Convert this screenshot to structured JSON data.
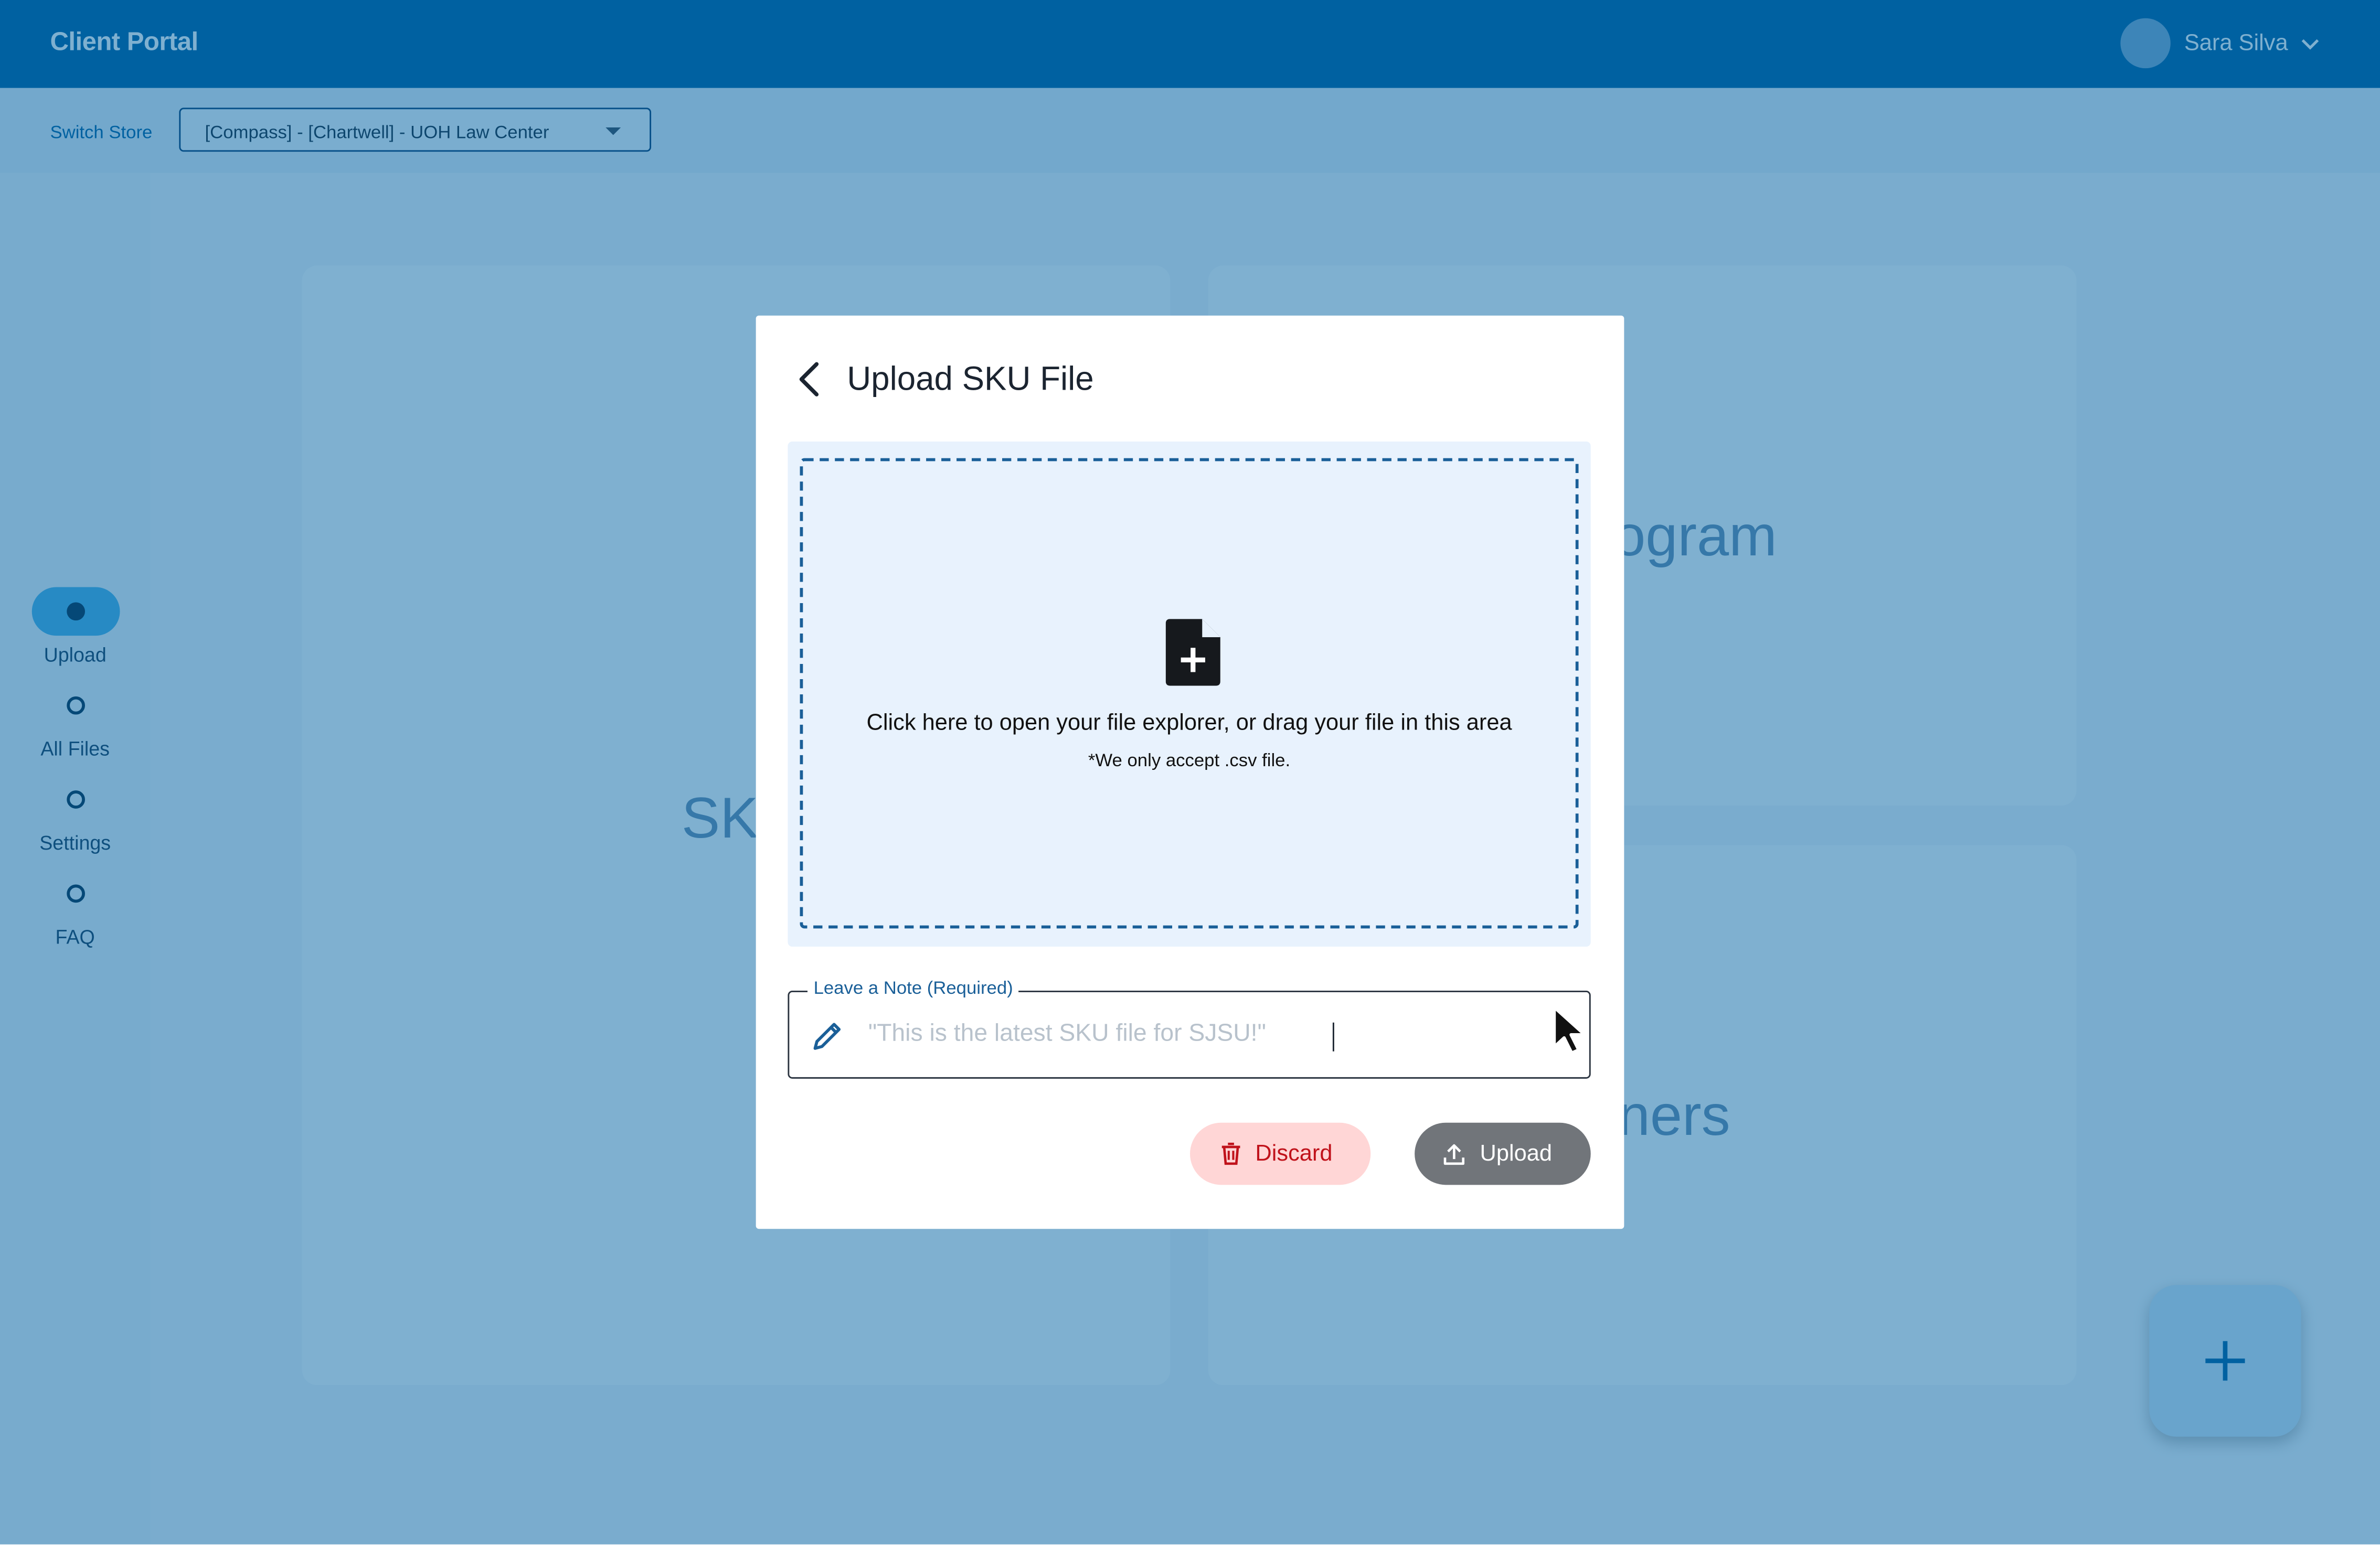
{
  "app": {
    "title": "Client Portal",
    "user_name": "Sara Silva"
  },
  "store_bar": {
    "switch_label": "Switch Store",
    "selected_store": "[Compass] - [Chartwell] - UOH Law Center"
  },
  "sidebar": {
    "items": [
      {
        "label": "Upload",
        "active": true
      },
      {
        "label": "All Files",
        "active": false
      },
      {
        "label": "Settings",
        "active": false
      },
      {
        "label": "FAQ",
        "active": false
      }
    ]
  },
  "cards": {
    "left_title": "SK",
    "right_top_title": "ogram",
    "right_bottom_title": "ners"
  },
  "modal": {
    "title": "Upload SKU File",
    "dropzone_text": "Click here to open your file explorer, or drag your file in this area",
    "dropzone_hint": "*We only accept .csv file.",
    "note_label": "Leave a Note (Required)",
    "note_placeholder": "\"This is the latest SKU file for SJSU!\"",
    "note_value": "",
    "discard_label": "Discard",
    "upload_label": "Upload"
  },
  "colors": {
    "brand": "#0061a1",
    "discard_bg": "#ffd6d6",
    "discard_text": "#c0121b",
    "upload_bg": "#71757a",
    "dropzone_bg": "#e8f2fd"
  },
  "icons": {
    "back": "chevron-left-icon",
    "file": "file-plus-icon",
    "note": "pencil-icon",
    "discard": "trash-icon",
    "upload": "upload-icon",
    "fab": "plus-icon"
  }
}
